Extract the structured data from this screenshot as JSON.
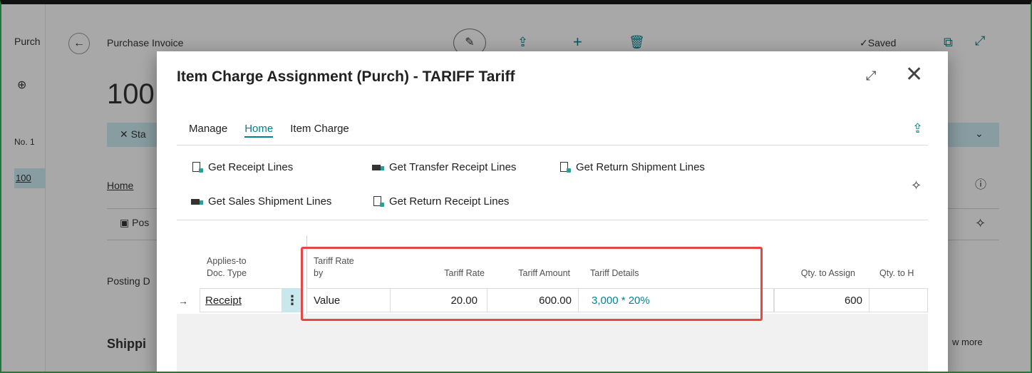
{
  "background": {
    "nav_label": "Purch",
    "page_title": "Purchase Invoice",
    "invoice_number": "100",
    "status_filter": "Sta",
    "no_label": "No. 1",
    "selected_row": "100",
    "home_tab": "Home",
    "post_action": "Pos",
    "posting_label": "Posting D",
    "shipping_label": "Shippi",
    "saved_label": "Saved",
    "show_more": "w more"
  },
  "dialog": {
    "title": "Item Charge Assignment (Purch) - TARIFF Tariff",
    "tabs": [
      {
        "label": "Manage"
      },
      {
        "label": "Home"
      },
      {
        "label": "Item Charge"
      }
    ],
    "actions": {
      "get_receipt_lines": "Get Receipt Lines",
      "get_transfer_receipt_lines": "Get Transfer Receipt Lines",
      "get_return_shipment_lines": "Get Return Shipment Lines",
      "get_sales_shipment_lines": "Get Sales Shipment Lines",
      "get_return_receipt_lines": "Get Return Receipt Lines"
    },
    "columns": {
      "applies_to_doc_type_1": "Applies-to",
      "applies_to_doc_type_2": "Doc. Type",
      "tariff_rate_by_1": "Tariff Rate",
      "tariff_rate_by_2": "by",
      "tariff_rate": "Tariff Rate",
      "tariff_amount": "Tariff Amount",
      "tariff_details": "Tariff Details",
      "qty_to_assign": "Qty. to Assign",
      "qty_to_handle": "Qty. to H"
    },
    "row": {
      "applies_to_doc_type": "Receipt",
      "tariff_rate_by": "Value",
      "tariff_rate": "20.00",
      "tariff_amount": "600.00",
      "tariff_details": "3,000 * 20%",
      "qty_to_assign": "600"
    }
  },
  "icons": {
    "back": "back-arrow-icon",
    "edit": "pencil-icon",
    "share": "share-icon",
    "add": "plus-icon",
    "delete": "trash-icon",
    "expand": "expand-icon",
    "close": "close-icon",
    "pin": "pin-icon",
    "info": "info-icon",
    "row_indicator": "arrow-right-icon",
    "row_menu": "ellipsis-vertical-icon"
  },
  "colors": {
    "accent": "#00838f",
    "highlight": "#e84545",
    "selection": "#c9e8ee"
  }
}
